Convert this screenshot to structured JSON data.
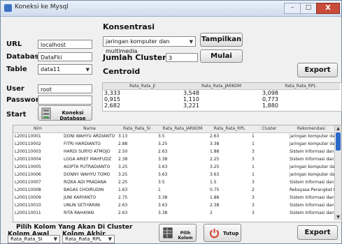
{
  "window": {
    "title": "Koneksi ke Mysql",
    "min_label": "–",
    "max_label": "□",
    "close_label": "X"
  },
  "connection": {
    "url_label": "URL",
    "url_value": "localhost",
    "database_label": "Database",
    "database_value": "DataFki",
    "table_label": "Table",
    "table_value": "data11",
    "user_label": "User",
    "user_value": "root",
    "password_label": "Password",
    "password_value": "",
    "start_label": "Start",
    "connect_button": "Koneksi Database"
  },
  "konsentrasi": {
    "heading": "Konsentrasi",
    "selected": "jaringan komputer dan multimedia",
    "show_button": "Tampilkan",
    "cluster_label": "Jumlah Cluster",
    "cluster_value": "3",
    "start_button": "Mulai",
    "export_button": "Export"
  },
  "centroid": {
    "heading": "Centroid",
    "columns": [
      "Rata_Rata_JI",
      "Rata_Rata_JARKOM",
      "Rata_Rata_RPL"
    ],
    "rows": [
      [
        "3,333",
        "3,548",
        "3,098"
      ],
      [
        "0,915",
        "1,110",
        "0,773"
      ],
      [
        "2,682",
        "3,221",
        "1,880"
      ]
    ]
  },
  "table": {
    "columns": [
      "Nim",
      "Nama",
      "Rata_Rata_SI",
      "Rata_Rata_JARKOM",
      "Rata_Rata_RPL",
      "Cluster",
      "Rekomendasi"
    ],
    "rows": [
      [
        "L200110001",
        "DONI WAHYU ARDIANTO",
        "3.13",
        "3.5",
        "2.63",
        "1",
        "jaringan komputer dan mult..."
      ],
      [
        "L200110002",
        "FITRI HARDIANTO",
        "2.88",
        "3.25",
        "3.38",
        "1",
        "jaringan komputer dan mult..."
      ],
      [
        "L200110003",
        "HARDI SURYO ATMOJO",
        "2.50",
        "2.63",
        "1.88",
        "3",
        "Sistem Informasi dan Enterp..."
      ],
      [
        "L200110004",
        "LOGA ARIEF MAHFUDZ",
        "2.38",
        "3.38",
        "2.25",
        "3",
        "Sistem Informasi dan Enterp..."
      ],
      [
        "L200110005",
        "AGIPTA PUTRADIANTO",
        "3.25",
        "3.63",
        "3.25",
        "1",
        "jaringan komputer dan mult..."
      ],
      [
        "L200110006",
        "DONNY WAHYU TOMO",
        "3.25",
        "3.63",
        "3.63",
        "1",
        "jaringan komputer dan mult..."
      ],
      [
        "L200110007",
        "RIZKA ADI PRADANA",
        "2.25",
        "3.5",
        "1.5",
        "3",
        "Sistem Informasi dan Enterp..."
      ],
      [
        "L200110008",
        "BAGAS CHOIRUDIN",
        "1.63",
        "1",
        "0.75",
        "2",
        "Rekayasa Perangkat Lunak ..."
      ],
      [
        "L200110009",
        "JUNI KARYANTO",
        "2.75",
        "3.38",
        "1.88",
        "3",
        "Sistem Informasi dan Enterp..."
      ],
      [
        "L200110010",
        "UNUN SETIYARINI",
        "2.63",
        "3.63",
        "2.38",
        "3",
        "Sistem Informasi dan Enterp..."
      ],
      [
        "L200110011",
        "RITA RAHAYAN",
        "2.63",
        "3.38",
        "2",
        "3",
        "Sistem Informasi dan Enterp..."
      ]
    ]
  },
  "bottom": {
    "heading": "Pilih Kolom Yang Akan Di Cluster",
    "awal_label": "Kolom Awal",
    "awal_value": "Rata_Rata_SI",
    "akhir_label": "Kolom Akhir",
    "akhir_value": "Rata_Rata_RPL",
    "pilih_button": "Pilih Kolom",
    "tutup_button": "Tutup",
    "export_button": "Export"
  },
  "icons": {
    "app": "window-icon",
    "db": "database-icon",
    "grid": "table-icon",
    "power": "power-icon"
  },
  "colors": {
    "accent": "#2c68c9",
    "close": "#c94c3b",
    "power": "#d23b2c"
  }
}
